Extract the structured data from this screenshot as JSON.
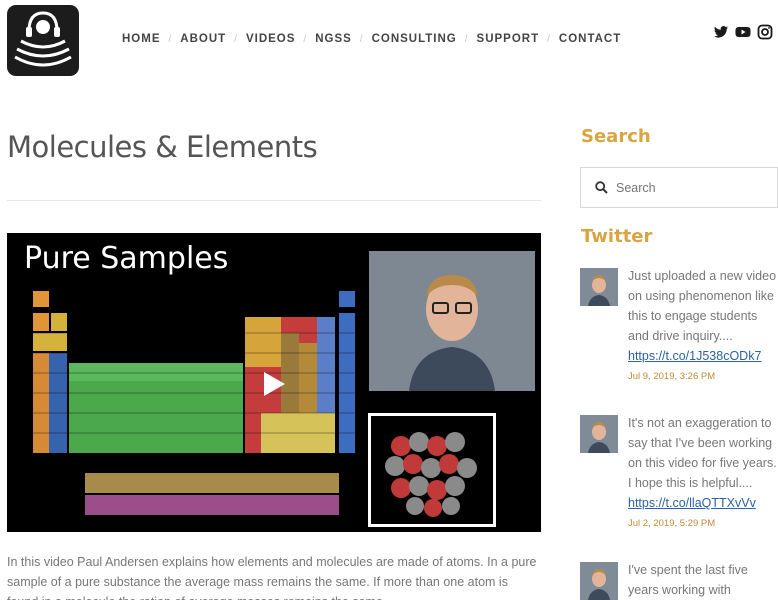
{
  "nav": {
    "items": [
      "HOME",
      "ABOUT",
      "VIDEOS",
      "NGSS",
      "CONSULTING",
      "SUPPORT",
      "CONTACT"
    ]
  },
  "social": [
    "twitter-icon",
    "youtube-icon",
    "instagram-icon"
  ],
  "page": {
    "title": "Molecules & Elements",
    "description": "In this video Paul Andersen explains how elements and molecules are made of atoms. In a pure sample of a pure substance the average mass remains the same. If more than one atom is found in a molecule the ration of average masses remains the same."
  },
  "video": {
    "heading": "Pure Samples"
  },
  "sidebar": {
    "search_heading": "Search",
    "search_placeholder": "Search",
    "twitter_heading": "Twitter",
    "tweets": [
      {
        "text": "Just uploaded a new video on using phenomenon like this to engage students and drive inquiry....",
        "link": "https://t.co/1J538cODk7",
        "time": "Jul 9, 2019, 3:26 PM"
      },
      {
        "text": "It's not an exaggeration to say that I've been working on this video for five years. I hope this is helpful....",
        "link": "https://t.co/llaQTTXvVv",
        "time": "Jul 2, 2019, 5:29 PM"
      },
      {
        "text": "I've spent the last five years working with",
        "link": "",
        "time": ""
      }
    ]
  },
  "colors": {
    "accent": "#d9a441",
    "link": "#2b62a8"
  }
}
